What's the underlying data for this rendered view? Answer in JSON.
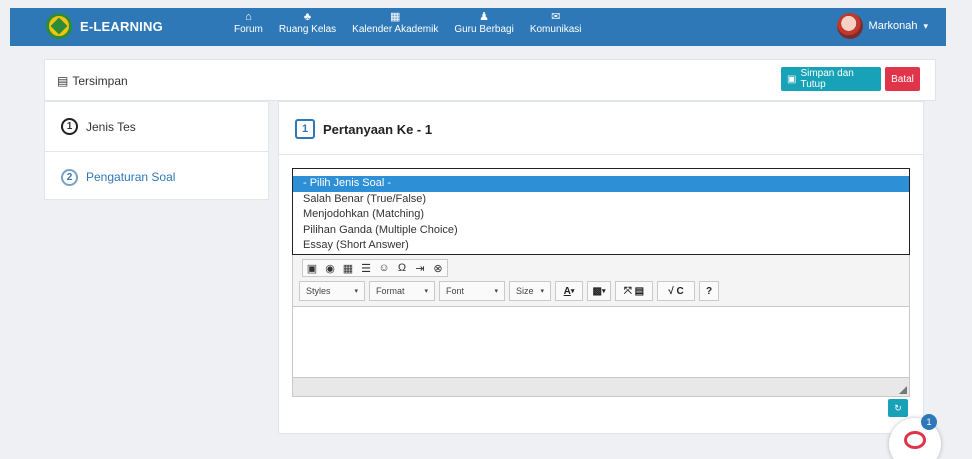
{
  "brand": {
    "name": "E-LEARNING"
  },
  "nav": [
    {
      "label": "Forum",
      "icon": "home-icon",
      "glyph": "⌂"
    },
    {
      "label": "Ruang Kelas",
      "icon": "class-icon",
      "glyph": "♣"
    },
    {
      "label": "Kalender Akademik",
      "icon": "calendar-icon",
      "glyph": "▦"
    },
    {
      "label": "Guru Berbagi",
      "icon": "user-icon",
      "glyph": "♟"
    },
    {
      "label": "Komunikasi",
      "icon": "mail-icon",
      "glyph": "✉"
    }
  ],
  "user": {
    "name": "Markonah"
  },
  "header": {
    "saved_label": "Tersimpan",
    "save_close_label": "Simpan dan Tutup",
    "cancel_label": "Batal"
  },
  "steps": [
    {
      "number": "1",
      "label": "Jenis Tes"
    },
    {
      "number": "2",
      "label": "Pengaturan Soal"
    }
  ],
  "question": {
    "number": "1",
    "title": "Pertanyaan Ke - 1"
  },
  "question_type_options": [
    "- Pilih Jenis Soal -",
    "Salah Benar (True/False)",
    "Menjodohkan (Matching)",
    "Pilihan Ganda (Multiple Choice)",
    "Essay (Short Answer)"
  ],
  "editor": {
    "styles_label": "Styles",
    "format_label": "Format",
    "font_label": "Font",
    "size_label": "Size",
    "help_label": "?"
  },
  "chat": {
    "badge": "1"
  },
  "colors": {
    "topbar": "#2f78b7",
    "accent": "#17a2b8",
    "danger": "#e0344b",
    "selected": "#2d8fd5"
  }
}
